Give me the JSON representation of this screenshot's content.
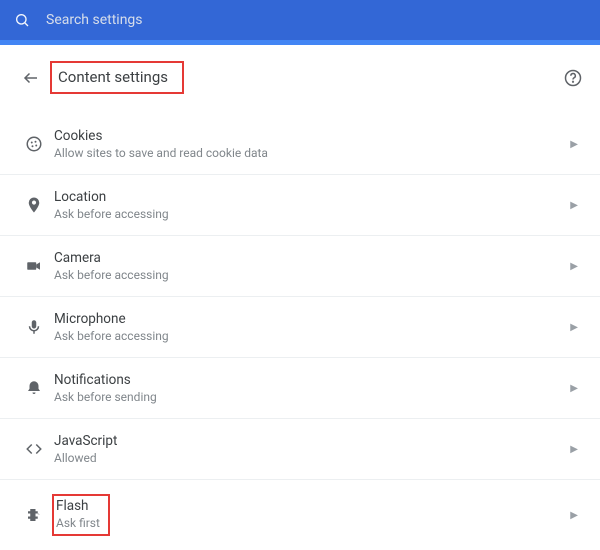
{
  "search": {
    "placeholder": "Search settings"
  },
  "header": {
    "title": "Content settings"
  },
  "items": [
    {
      "title": "Cookies",
      "sub": "Allow sites to save and read cookie data"
    },
    {
      "title": "Location",
      "sub": "Ask before accessing"
    },
    {
      "title": "Camera",
      "sub": "Ask before accessing"
    },
    {
      "title": "Microphone",
      "sub": "Ask before accessing"
    },
    {
      "title": "Notifications",
      "sub": "Ask before sending"
    },
    {
      "title": "JavaScript",
      "sub": "Allowed"
    },
    {
      "title": "Flash",
      "sub": "Ask first"
    }
  ]
}
